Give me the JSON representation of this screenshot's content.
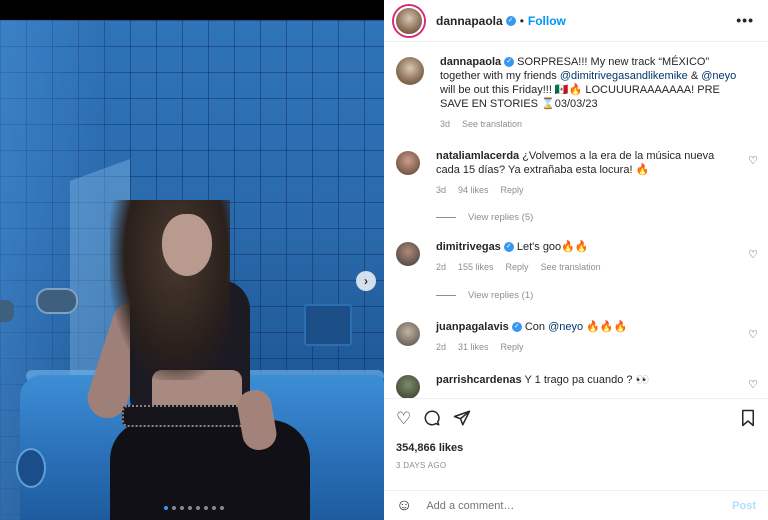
{
  "post_header": {
    "username": "dannapaola",
    "separator": "•",
    "follow_label": "Follow",
    "more_label": "•••"
  },
  "media": {
    "next_label": "›",
    "slide_count": 8,
    "active_slide": 1
  },
  "caption": {
    "username": "dannapaola",
    "text_part1": " SORPRESA!!! My new track “MÉXICO” together with my friends ",
    "mention1": "@dimitrivegasandlikemike",
    "text_part2": " & ",
    "mention2": "@neyo",
    "text_part3": " will be out this Friday!!! 🇲🇽🔥 LOCUUURAAAAAAA! PRE SAVE EN STORIES ⌛03/03/23",
    "time": "3d",
    "translate_label": "See translation"
  },
  "comments": [
    {
      "username": "nataliamlacerda",
      "text": " ¿Volvemos a la era de la música nueva cada 15 días? Ya extrañaba esta locura! 🔥",
      "time": "3d",
      "likes": "94 likes",
      "reply": "Reply",
      "replies": "View replies (5)"
    },
    {
      "username": "dimitrivegas",
      "text": " Let's goo🔥🔥",
      "time": "2d",
      "likes": "155 likes",
      "reply": "Reply",
      "translate": "See translation",
      "replies": "View replies (1)"
    },
    {
      "username": "juanpagalavis",
      "text_pre": " Con ",
      "mention": "@neyo",
      "text_post": " 🔥🔥🔥",
      "time": "2d",
      "likes": "31 likes",
      "reply": "Reply"
    },
    {
      "username": "parrishcardenas",
      "text": " Y 1 trago pa cuando ? 👀"
    }
  ],
  "actions": {
    "likes": "354,866 likes",
    "ago": "3 DAYS AGO"
  },
  "add_comment": {
    "placeholder": "Add a comment…",
    "post_label": "Post"
  },
  "colors": {
    "accent": "#0095f6",
    "verified": "#3897f0",
    "mention": "#00376b",
    "muted": "#8e8e8e"
  },
  "icons": [
    "verified-badge-icon",
    "more-options-icon",
    "next-slide-icon",
    "heart-icon",
    "comment-icon",
    "share-icon",
    "bookmark-icon",
    "emoji-icon"
  ]
}
